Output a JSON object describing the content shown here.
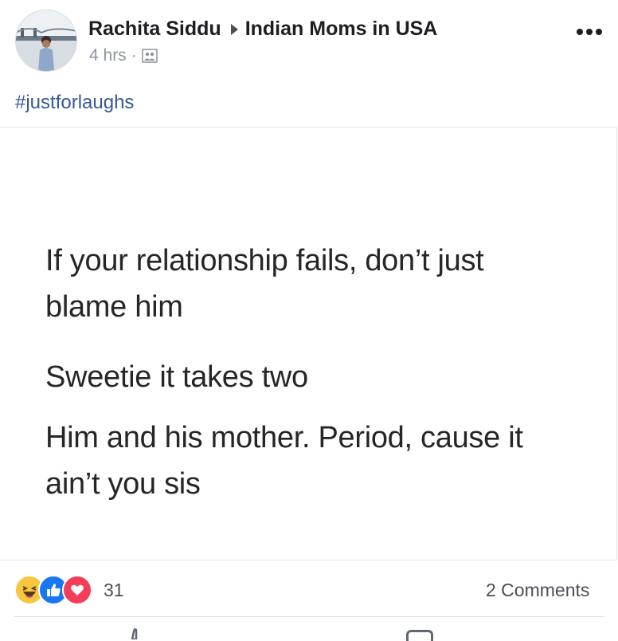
{
  "post": {
    "author": "Rachita Siddu",
    "group": "Indian Moms in USA",
    "time": "4 hrs",
    "separator": "·",
    "audience_icon": "group-audience-icon",
    "more_icon": "more-options-icon",
    "hashtag": "#justforlaughs"
  },
  "image_text": {
    "line1": "If your relationship fails, don’t just",
    "line2": "blame him",
    "line3": "Sweetie it takes two",
    "line4": "Him and his mother. Period, cause it",
    "line5": "ain’t you sis"
  },
  "footer": {
    "reaction_icons": [
      "haha-reaction-icon",
      "like-reaction-icon",
      "love-reaction-icon"
    ],
    "reaction_count": "31",
    "comments": "2 Comments"
  },
  "colors": {
    "link": "#385898",
    "like": "#1877f2",
    "love": "#f33e58",
    "haha": "#f7c740"
  }
}
